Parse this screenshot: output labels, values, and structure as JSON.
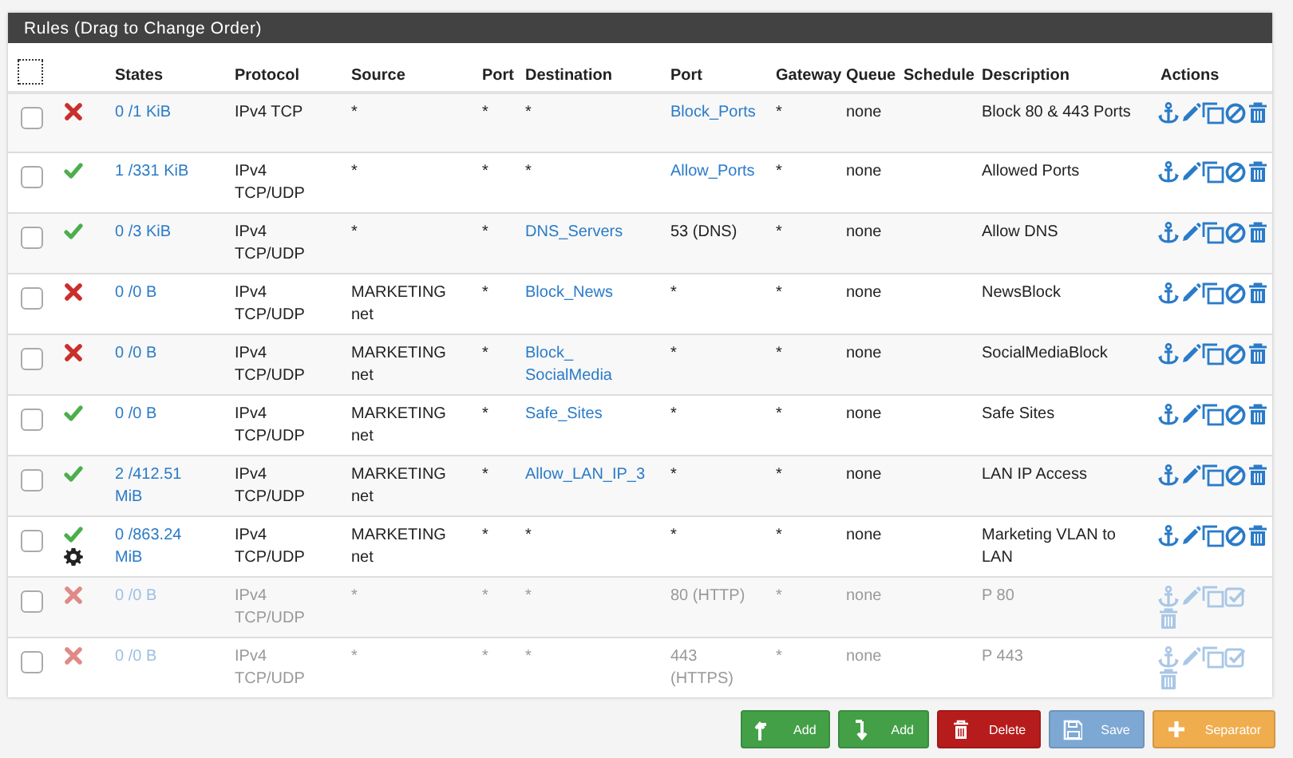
{
  "panel": {
    "title": "Rules (Drag to Change Order)"
  },
  "select_all": {
    "checked": false
  },
  "columns": [
    "States",
    "Protocol",
    "Source",
    "Port",
    "Destination",
    "Port",
    "Gateway",
    "Queue",
    "Schedule",
    "Description",
    "Actions"
  ],
  "rows": [
    {
      "checked": false,
      "blocked": true,
      "disabled": false,
      "advanced": false,
      "states": "0 /1 KiB",
      "protocol": "IPv4 TCP",
      "source": "*",
      "source_port": "*",
      "destination": "*",
      "destination_alias": false,
      "port": "Block_Ports",
      "port_alias": true,
      "gateway": "*",
      "queue": "none",
      "description": "Block 80 & 443 Ports"
    },
    {
      "checked": false,
      "blocked": false,
      "disabled": false,
      "advanced": false,
      "states": "1 /331 KiB",
      "protocol": "IPv4 TCP/UDP",
      "source": "*",
      "source_port": "*",
      "destination": "*",
      "destination_alias": false,
      "port": "Allow_Ports",
      "port_alias": true,
      "gateway": "*",
      "queue": "none",
      "description": "Allowed Ports"
    },
    {
      "checked": false,
      "blocked": false,
      "disabled": false,
      "advanced": false,
      "states": "0 /3 KiB",
      "protocol": "IPv4 TCP/UDP",
      "source": "*",
      "source_port": "*",
      "destination": "DNS_Servers",
      "destination_alias": true,
      "port": "53 (DNS)",
      "port_alias": false,
      "gateway": "*",
      "queue": "none",
      "description": "Allow DNS"
    },
    {
      "checked": false,
      "blocked": true,
      "disabled": false,
      "advanced": false,
      "states": "0 /0 B",
      "protocol": "IPv4 TCP/UDP",
      "source": "MARKETING net",
      "source_port": "*",
      "destination": "Block_News",
      "destination_alias": true,
      "port": "*",
      "port_alias": false,
      "gateway": "*",
      "queue": "none",
      "description": "NewsBlock"
    },
    {
      "checked": false,
      "blocked": true,
      "disabled": false,
      "advanced": false,
      "states": "0 /0 B",
      "protocol": "IPv4 TCP/UDP",
      "source": "MARKETING net",
      "source_port": "*",
      "destination": "Block_SocialMedia",
      "destination_alias": true,
      "port": "*",
      "port_alias": false,
      "gateway": "*",
      "queue": "none",
      "description": "SocialMediaBlock"
    },
    {
      "checked": false,
      "blocked": false,
      "disabled": false,
      "advanced": false,
      "states": "0 /0 B",
      "protocol": "IPv4 TCP/UDP",
      "source": "MARKETING net",
      "source_port": "*",
      "destination": "Safe_Sites",
      "destination_alias": true,
      "port": "*",
      "port_alias": false,
      "gateway": "*",
      "queue": "none",
      "description": "Safe Sites"
    },
    {
      "checked": false,
      "blocked": false,
      "disabled": false,
      "advanced": false,
      "states": "2 /412.51 MiB",
      "protocol": "IPv4 TCP/UDP",
      "source": "MARKETING net",
      "source_port": "*",
      "destination": "Allow_LAN_IP_3",
      "destination_alias": true,
      "port": "*",
      "port_alias": false,
      "gateway": "*",
      "queue": "none",
      "description": "LAN IP Access"
    },
    {
      "checked": false,
      "blocked": false,
      "disabled": false,
      "advanced": true,
      "states": "0 /863.24 MiB",
      "protocol": "IPv4 TCP/UDP",
      "source": "MARKETING net",
      "source_port": "*",
      "destination": "*",
      "destination_alias": false,
      "port": "*",
      "port_alias": false,
      "gateway": "*",
      "queue": "none",
      "description": "Marketing VLAN to LAN"
    },
    {
      "checked": false,
      "blocked": true,
      "disabled": true,
      "advanced": false,
      "states": "0 /0 B",
      "protocol": "IPv4 TCP/UDP",
      "source": "*",
      "source_port": "*",
      "destination": "*",
      "destination_alias": false,
      "port": "80 (HTTP)",
      "port_alias": false,
      "gateway": "*",
      "queue": "none",
      "description": "P 80"
    },
    {
      "checked": false,
      "blocked": true,
      "disabled": true,
      "advanced": false,
      "states": "0 /0 B",
      "protocol": "IPv4 TCP/UDP",
      "source": "*",
      "source_port": "*",
      "destination": "*",
      "destination_alias": false,
      "port": "443 (HTTPS)",
      "port_alias": false,
      "gateway": "*",
      "queue": "none",
      "description": "P 443"
    }
  ],
  "buttons": [
    {
      "label": "Add",
      "kind": "add-top"
    },
    {
      "label": "Add",
      "kind": "add-bottom"
    },
    {
      "label": "Delete",
      "kind": "delete"
    },
    {
      "label": "Save",
      "kind": "save"
    },
    {
      "label": "Separator",
      "kind": "separator"
    }
  ]
}
